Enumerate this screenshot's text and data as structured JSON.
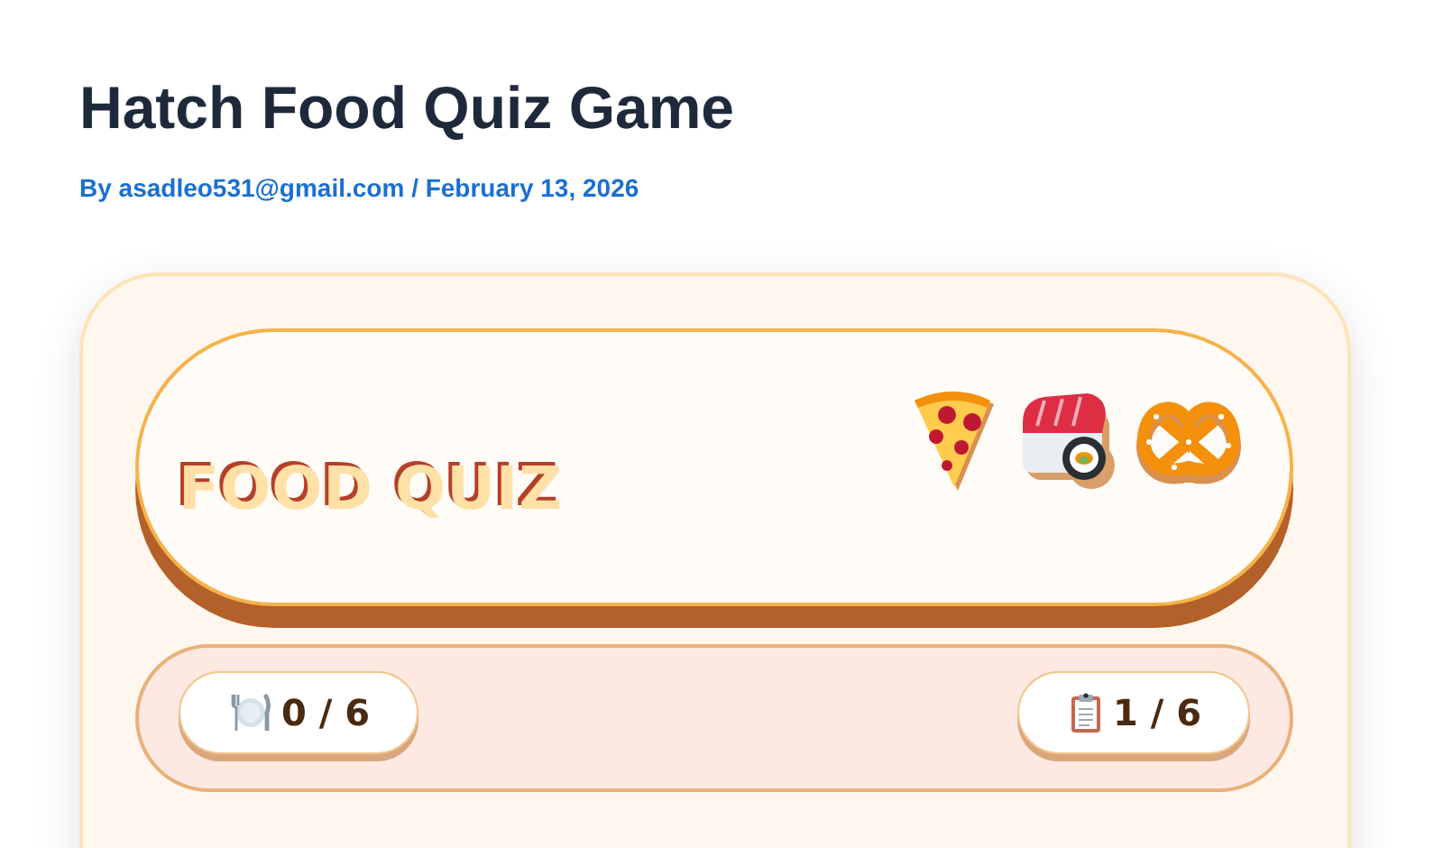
{
  "post": {
    "title": "Hatch Food Quiz Game",
    "byline": "By asadleo531@gmail.com / February 13, 2026"
  },
  "quiz": {
    "title": "FOOD QUIZ",
    "foods": [
      {
        "kind": "pizza"
      },
      {
        "kind": "sushi"
      },
      {
        "kind": "pretzel"
      }
    ],
    "stats": [
      {
        "kind": "score",
        "value": "0 / 6"
      },
      {
        "kind": "question",
        "value": "1 / 6"
      }
    ]
  }
}
